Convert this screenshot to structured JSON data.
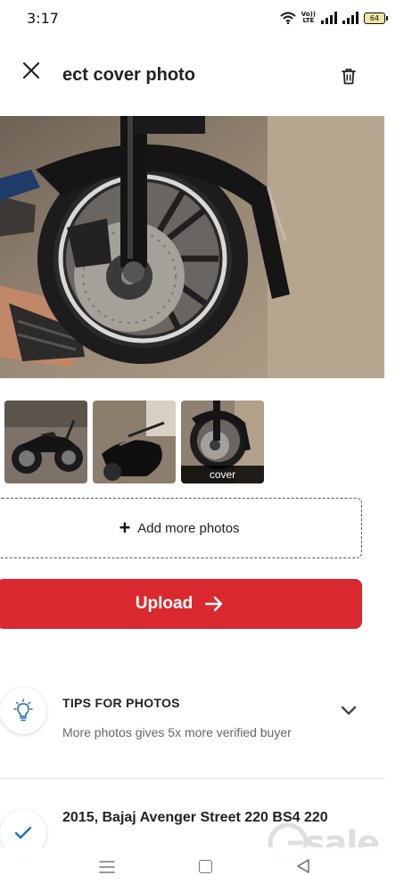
{
  "status_bar": {
    "time": "3:17",
    "volte_top": "Vo))",
    "volte_bottom": "LTE",
    "battery": "64"
  },
  "header": {
    "title": "ect cover photo",
    "close_icon": "close-icon",
    "delete_icon": "trash-icon"
  },
  "main_photo": {
    "subject": "motorcycle-front-wheel-photo"
  },
  "thumbnails": [
    {
      "subject": "motorcycle-side-photo"
    },
    {
      "subject": "motorcycle-tank-photo"
    },
    {
      "subject": "motorcycle-front-wheel-photo",
      "label": "cover"
    }
  ],
  "add_more": {
    "icon": "plus-icon",
    "label": "Add more photos"
  },
  "upload": {
    "label": "Upload",
    "icon": "arrow-right-icon",
    "color": "#d9282e"
  },
  "tips": {
    "icon": "lightbulb-icon",
    "title": "TIPS FOR PHOTOS",
    "text": "More photos gives 5x more verified buyer",
    "chevron": "chevron-down-icon"
  },
  "listing": {
    "icon": "check-icon",
    "title": "2015, Bajaj Avenger Street 220 BS4 220"
  },
  "nav": {
    "menu_icon": "menu-icon",
    "home_icon": "home-icon",
    "back_icon": "back-icon"
  },
  "watermark": {
    "text": "sale",
    "logo_letter": "G"
  },
  "colors": {
    "accent_red": "#d9282e",
    "tips_icon_blue": "#2b6fa8",
    "check_blue": "#1e6fb3"
  }
}
